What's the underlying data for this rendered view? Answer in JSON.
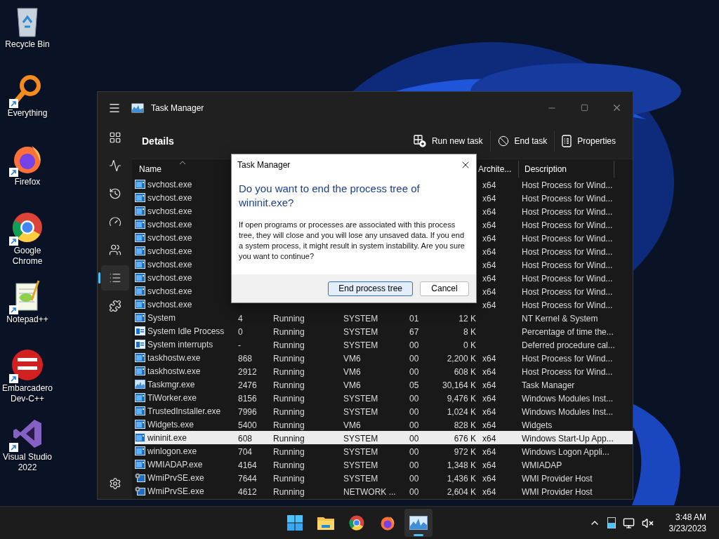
{
  "desktop_icons": [
    {
      "label": "Recycle Bin",
      "kind": "bin",
      "shortcut": false
    },
    {
      "label": "Everything",
      "kind": "search",
      "shortcut": true
    },
    {
      "label": "Firefox",
      "kind": "firefox",
      "shortcut": true
    },
    {
      "label": "Google Chrome",
      "kind": "chrome",
      "shortcut": true
    },
    {
      "label": "Notepad++",
      "kind": "notepad",
      "shortcut": true
    },
    {
      "label": "Embarcadero Dev-C++",
      "kind": "devcpp",
      "shortcut": true
    },
    {
      "label": "Visual Studio 2022",
      "kind": "vs",
      "shortcut": true
    }
  ],
  "window": {
    "title": "Task Manager"
  },
  "sidebar": {
    "items": [
      {
        "selected": false
      },
      {
        "selected": false
      },
      {
        "selected": false
      },
      {
        "selected": false
      },
      {
        "selected": false
      },
      {
        "selected": true
      },
      {
        "selected": false
      }
    ],
    "settings": {
      "selected": false
    }
  },
  "page_title": "Details",
  "toolbar": [
    {
      "kind": "run",
      "label": "Run new task"
    },
    {
      "kind": "end",
      "label": "End task"
    },
    {
      "kind": "properties",
      "label": "Properties"
    }
  ],
  "table": {
    "columns": [
      {
        "label": "Name",
        "sorted": true
      },
      {
        "label": "Archite..."
      },
      {
        "label": "Description"
      }
    ],
    "rows": [
      {
        "kind": "app",
        "name": "svchost.exe",
        "arch": "x64",
        "description": "Host Process for Wind...",
        "selected": false
      },
      {
        "kind": "app",
        "name": "svchost.exe",
        "arch": "x64",
        "description": "Host Process for Wind...",
        "selected": false
      },
      {
        "kind": "app",
        "name": "svchost.exe",
        "arch": "x64",
        "description": "Host Process for Wind...",
        "selected": false
      },
      {
        "kind": "app",
        "name": "svchost.exe",
        "arch": "x64",
        "description": "Host Process for Wind...",
        "selected": false
      },
      {
        "kind": "app",
        "name": "svchost.exe",
        "arch": "x64",
        "description": "Host Process for Wind...",
        "selected": false
      },
      {
        "kind": "app",
        "name": "svchost.exe",
        "arch": "x64",
        "description": "Host Process for Wind...",
        "selected": false
      },
      {
        "kind": "app",
        "name": "svchost.exe",
        "arch": "x64",
        "description": "Host Process for Wind...",
        "selected": false
      },
      {
        "kind": "app",
        "name": "svchost.exe",
        "arch": "x64",
        "description": "Host Process for Wind...",
        "selected": false
      },
      {
        "kind": "app",
        "name": "svchost.exe",
        "arch": "x64",
        "description": "Host Process for Wind...",
        "selected": false
      },
      {
        "kind": "app",
        "name": "svchost.exe",
        "arch": "x64",
        "description": "Host Process for Wind...",
        "selected": false
      },
      {
        "kind": "app",
        "name": "System",
        "pid": "4",
        "status": "Running",
        "user": "SYSTEM",
        "cpu": "01",
        "memory": "12 K",
        "description": "NT Kernel & System",
        "selected": false
      },
      {
        "kind": "sys",
        "name": "System Idle Process",
        "pid": "0",
        "status": "Running",
        "user": "SYSTEM",
        "cpu": "67",
        "memory": "8 K",
        "description": "Percentage of time the...",
        "selected": false
      },
      {
        "kind": "sys",
        "name": "System interrupts",
        "pid": "-",
        "status": "Running",
        "user": "SYSTEM",
        "cpu": "00",
        "memory": "0 K",
        "description": "Deferred procedure cal...",
        "selected": false
      },
      {
        "kind": "app",
        "name": "taskhostw.exe",
        "pid": "868",
        "status": "Running",
        "user": "VM6",
        "cpu": "00",
        "memory": "2,200 K",
        "arch": "x64",
        "description": "Host Process for Wind...",
        "selected": false
      },
      {
        "kind": "app",
        "name": "taskhostw.exe",
        "pid": "2912",
        "status": "Running",
        "user": "VM6",
        "cpu": "00",
        "memory": "608 K",
        "arch": "x64",
        "description": "Host Process for Wind...",
        "selected": false
      },
      {
        "kind": "monitor",
        "name": "Taskmgr.exe",
        "pid": "2476",
        "status": "Running",
        "user": "VM6",
        "cpu": "05",
        "memory": "30,164 K",
        "arch": "x64",
        "description": "Task Manager",
        "selected": false
      },
      {
        "kind": "app",
        "name": "TiWorker.exe",
        "pid": "8156",
        "status": "Running",
        "user": "SYSTEM",
        "cpu": "00",
        "memory": "9,476 K",
        "arch": "x64",
        "description": "Windows Modules Inst...",
        "selected": false
      },
      {
        "kind": "app",
        "name": "TrustedInstaller.exe",
        "pid": "7996",
        "status": "Running",
        "user": "SYSTEM",
        "cpu": "00",
        "memory": "1,024 K",
        "arch": "x64",
        "description": "Windows Modules Inst...",
        "selected": false
      },
      {
        "kind": "app",
        "name": "Widgets.exe",
        "pid": "5400",
        "status": "Running",
        "user": "VM6",
        "cpu": "00",
        "memory": "828 K",
        "arch": "x64",
        "description": "Widgets",
        "selected": false
      },
      {
        "kind": "app",
        "name": "wininit.exe",
        "pid": "608",
        "status": "Running",
        "user": "SYSTEM",
        "cpu": "00",
        "memory": "676 K",
        "arch": "x64",
        "description": "Windows Start-Up App...",
        "selected": true
      },
      {
        "kind": "app",
        "name": "winlogon.exe",
        "pid": "704",
        "status": "Running",
        "user": "SYSTEM",
        "cpu": "00",
        "memory": "972 K",
        "arch": "x64",
        "description": "Windows Logon Appli...",
        "selected": false
      },
      {
        "kind": "app",
        "name": "WMIADAP.exe",
        "pid": "4164",
        "status": "Running",
        "user": "SYSTEM",
        "cpu": "00",
        "memory": "1,348 K",
        "arch": "x64",
        "description": "WMIADAP",
        "selected": false
      },
      {
        "kind": "service",
        "name": "WmiPrvSE.exe",
        "pid": "7644",
        "status": "Running",
        "user": "SYSTEM",
        "cpu": "00",
        "memory": "1,436 K",
        "arch": "x64",
        "description": "WMI Provider Host",
        "selected": false
      },
      {
        "kind": "service",
        "name": "WmiPrvSE.exe",
        "pid": "4612",
        "status": "Running",
        "user": "NETWORK ...",
        "cpu": "00",
        "memory": "2,604 K",
        "arch": "x64",
        "description": "WMI Provider Host",
        "selected": false
      }
    ]
  },
  "dialog": {
    "title": "Task Manager",
    "heading": "Do you want to end the process tree of wininit.exe?",
    "message": "If open programs or processes are associated with this process tree, they will close and you will lose any unsaved data. If you end a system process, it might result in system instability. Are you sure you want to continue?",
    "buttons": [
      {
        "label": "End process tree",
        "focused": true
      },
      {
        "label": "Cancel",
        "focused": false
      }
    ]
  },
  "taskbar": {
    "apps": [
      {
        "kind": "start",
        "active": false
      },
      {
        "kind": "explorer",
        "active": false
      },
      {
        "kind": "chrome",
        "active": false
      },
      {
        "kind": "firefox",
        "active": false
      },
      {
        "kind": "taskmgr",
        "active": true
      }
    ],
    "time": "3:48 AM",
    "date": "3/23/2023"
  }
}
